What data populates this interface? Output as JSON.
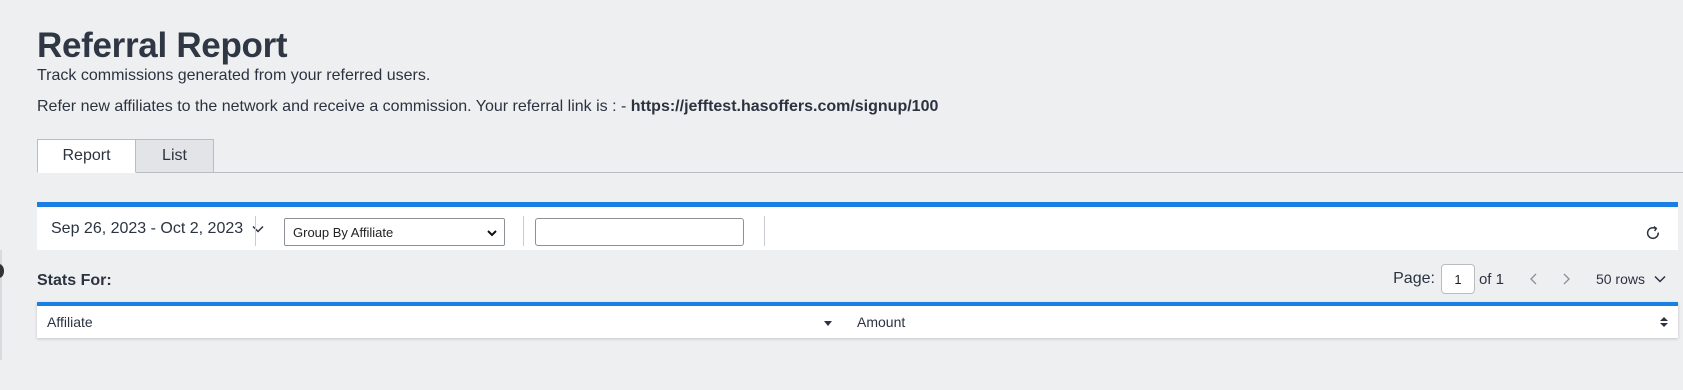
{
  "page": {
    "title": "Referral Report",
    "subtitle": "Track commissions generated from your referred users.",
    "referral_text": "Refer new affiliates to the network and receive a commission. Your referral link is : - ",
    "referral_link": "https://jefftest.hasoffers.com/signup/100"
  },
  "tabs": [
    {
      "label": "Report",
      "active": true
    },
    {
      "label": "List",
      "active": false
    }
  ],
  "filters": {
    "date_range": "Sep 26, 2023 - Oct 2, 2023",
    "group_by": "Group By Affiliate",
    "search_value": ""
  },
  "stats": {
    "label": "Stats For:",
    "page_label": "Page:",
    "page_number": "1",
    "of_total": "of 1",
    "rows_label": "50 rows"
  },
  "table": {
    "columns": [
      "Affiliate",
      "Amount"
    ]
  },
  "colors": {
    "accent": "#1a7fe3",
    "background": "#eeeff1",
    "text": "#2b3340"
  },
  "icons": {
    "date_chevron": "chevron-down-icon",
    "refresh": "refresh-icon",
    "prev": "chevron-left-icon",
    "next": "chevron-right-icon",
    "rows_chevron": "chevron-down-icon",
    "affiliate_sort": "caret-down-icon",
    "amount_sort": "sort-updown-icon"
  }
}
